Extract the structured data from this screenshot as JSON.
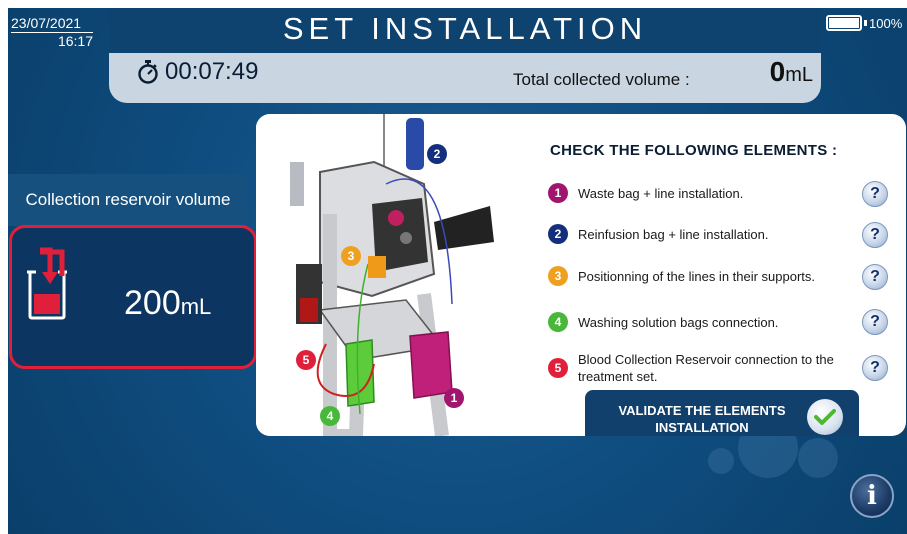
{
  "status": {
    "date": "23/07/2021",
    "time": "16:17",
    "battery": "100%"
  },
  "header": {
    "title": "SET INSTALLATION",
    "timer": "00:07:49",
    "total_volume_label": "Total collected volume :",
    "total_volume_value": "0",
    "total_volume_unit": "mL"
  },
  "collection": {
    "label": "Collection reservoir volume",
    "value": "200",
    "unit": "mL"
  },
  "checklist": {
    "title": "CHECK THE FOLLOWING ELEMENTS :",
    "items": [
      {
        "num": "1",
        "color": "#a0166e",
        "text": "Waste bag + line installation."
      },
      {
        "num": "2",
        "color": "#14307d",
        "text": "Reinfusion bag + line installation."
      },
      {
        "num": "3",
        "color": "#f0a020",
        "text": "Positionning of the lines in their supports."
      },
      {
        "num": "4",
        "color": "#48b83a",
        "text": "Washing solution bags connection."
      },
      {
        "num": "5",
        "color": "#e0203a",
        "text": "Blood Collection Reservoir connection to the treatment set."
      }
    ],
    "help_glyph": "?",
    "validate_label": "VALIDATE THE ELEMENTS INSTALLATION"
  },
  "machine_callouts": [
    "2",
    "3",
    "5",
    "1",
    "4"
  ],
  "info_glyph": "i",
  "icons": [
    "stopwatch-icon",
    "battery-icon",
    "reservoir-icon",
    "help-icon",
    "check-icon",
    "info-icon"
  ],
  "colors": {
    "background": "#0d4a7c",
    "header_bar": "#0e436f",
    "header_panel": "#c9d6e2",
    "alert_border": "#e0203a"
  }
}
